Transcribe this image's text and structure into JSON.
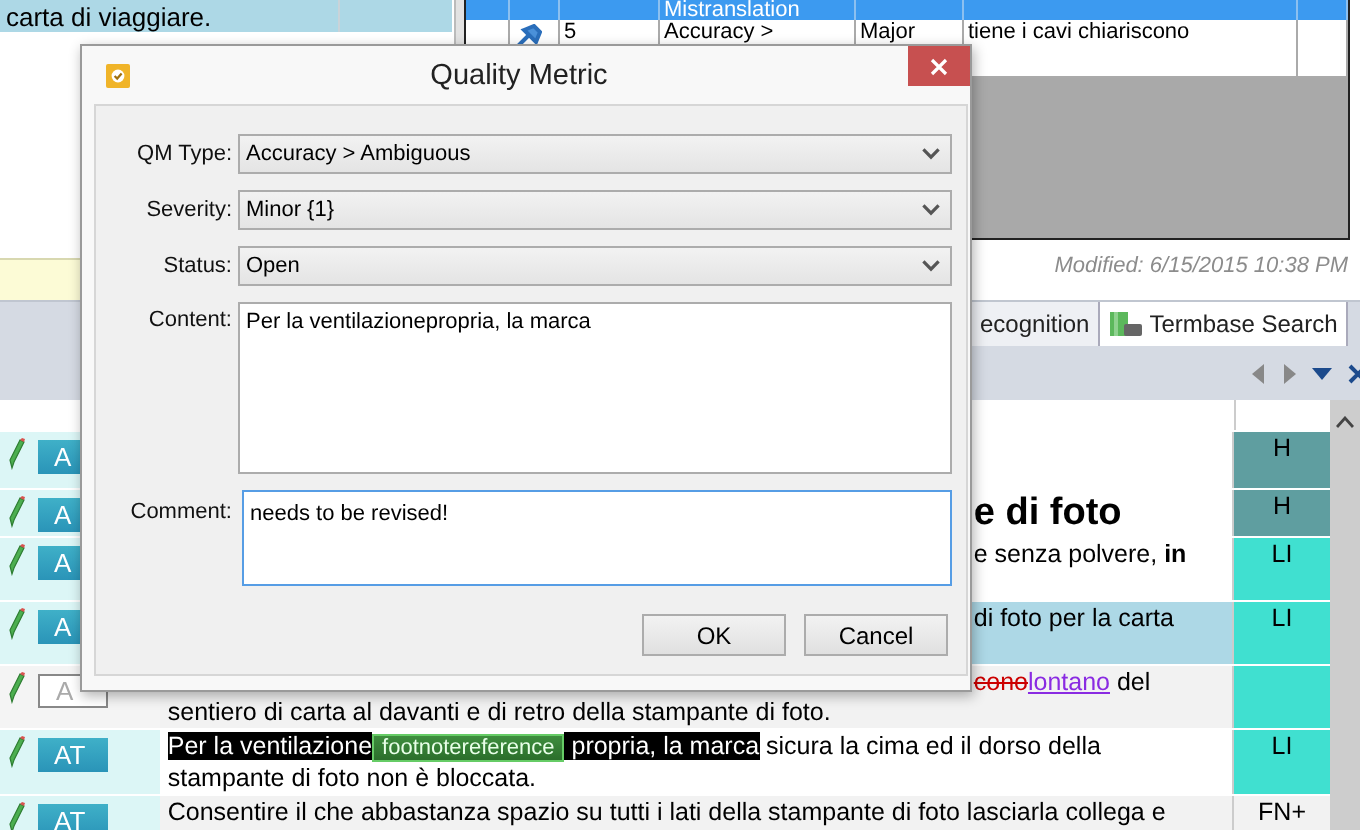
{
  "source_pane": {
    "row_text": "carta di viaggiare."
  },
  "qa_table": {
    "header": {
      "column_3": "Mistranslation"
    },
    "rows": [
      {
        "number": "5",
        "category": "Accuracy >",
        "severity": "Major",
        "text": "tiene i cavi chiariscono"
      }
    ],
    "modified": "Modified: 6/15/2015 10:38 PM"
  },
  "tabs": [
    {
      "label": "ecognition",
      "has_icon": false
    },
    {
      "label": "Termbase Search",
      "has_icon": true
    }
  ],
  "grid": {
    "rows": [
      {
        "badge": "A",
        "outlined": false,
        "selected": false,
        "shaded": false,
        "kind": "empty",
        "status": {
          "text": "H",
          "color": "#5f9ea0"
        }
      },
      {
        "badge": "A",
        "outlined": false,
        "selected": false,
        "shaded": false,
        "kind": "heading",
        "status": {
          "text": "H",
          "color": "#5f9ea0"
        },
        "lines": [
          {
            "after_dialog": true,
            "segments": [
              {
                "kind": "plain",
                "text": "e di foto"
              }
            ]
          }
        ]
      },
      {
        "badge": "A",
        "outlined": false,
        "selected": false,
        "shaded": false,
        "kind": "text",
        "status": {
          "text": "LI",
          "color": "#40e0d0"
        },
        "lines": [
          {
            "after_dialog": true,
            "segments": [
              {
                "kind": "plain",
                "text": "e senza polvere, **in**"
              }
            ]
          }
        ]
      },
      {
        "badge": "A",
        "outlined": false,
        "selected": true,
        "shaded": false,
        "kind": "text",
        "status": {
          "text": "LI",
          "color": "#40e0d0"
        },
        "lines": [
          {
            "after_dialog": true,
            "segments": [
              {
                "kind": "plain",
                "text": "di foto per la carta"
              }
            ]
          }
        ]
      },
      {
        "badge": "A",
        "outlined": true,
        "selected": false,
        "shaded": true,
        "kind": "text",
        "status": {
          "color": "#40e0d0"
        },
        "lines": [
          {
            "after_dialog": true,
            "segments": [
              {
                "kind": "deleted",
                "text": "cono"
              },
              {
                "kind": "inserted",
                "text": "lontano"
              },
              {
                "kind": "plain",
                "text": " del"
              }
            ]
          },
          {
            "after_dialog": false,
            "segments": [
              {
                "kind": "plain",
                "text": "sentiero di carta al davanti e di retro della stampante di foto."
              }
            ]
          }
        ]
      },
      {
        "badge": "AT",
        "outlined": false,
        "selected": false,
        "shaded": false,
        "kind": "text",
        "status": {
          "text": "LI",
          "color": "#40e0d0"
        },
        "lines": [
          {
            "after_dialog": false,
            "segments": [
              {
                "kind": "highlight",
                "text": "Per la ventilazione"
              },
              {
                "kind": "tag",
                "text": "footnotereference"
              },
              {
                "kind": "highlight",
                "text": " propria, la marca"
              },
              {
                "kind": "plain",
                "text": " sicura la cima ed il dorso della"
              }
            ]
          },
          {
            "after_dialog": false,
            "segments": [
              {
                "kind": "plain",
                "text": "stampante di foto non è bloccata."
              }
            ]
          }
        ]
      },
      {
        "badge": "AT",
        "outlined": false,
        "selected": false,
        "shaded": true,
        "kind": "text",
        "status": {
          "text": "FN+",
          "color": "#f2f2f2"
        },
        "lines": [
          {
            "after_dialog": false,
            "segments": [
              {
                "kind": "plain",
                "text": "Consentire il che abbastanza spazio su tutti i lati della stampante di foto lasciarla collega e"
              }
            ]
          }
        ]
      }
    ]
  },
  "dialog": {
    "title": "Quality Metric",
    "selects": [
      {
        "label": "QM Type:",
        "value": "Accuracy > Ambiguous"
      },
      {
        "label": "Severity:",
        "value": "Minor {1}"
      },
      {
        "label": "Status:",
        "value": "Open"
      }
    ],
    "content": {
      "label": "Content:",
      "value": "Per la ventilazionepropria, la marca"
    },
    "comment": {
      "label": "Comment:",
      "value": "needs to be revised!",
      "focused": true
    },
    "buttons": [
      "OK",
      "Cancel"
    ]
  }
}
